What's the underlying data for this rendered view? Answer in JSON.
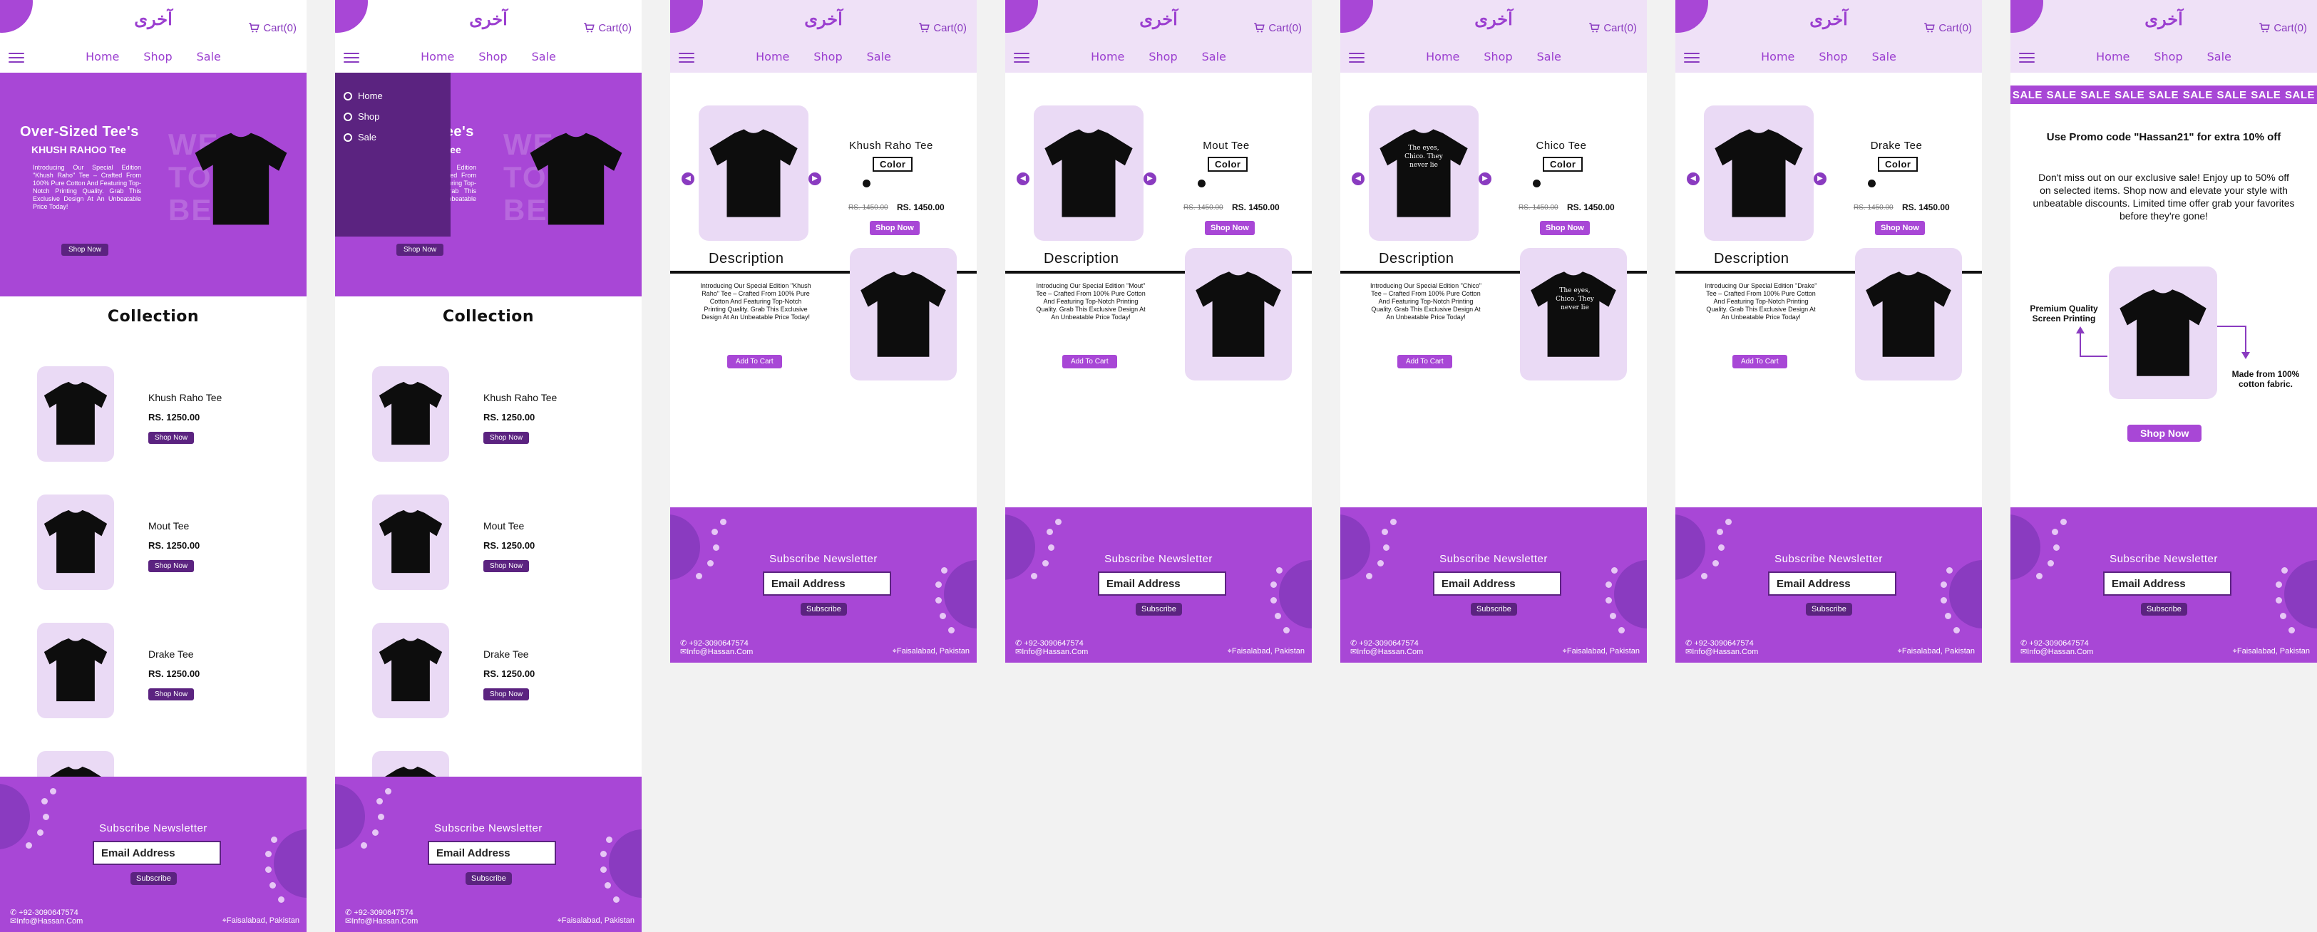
{
  "brand": {
    "logo_text": "آخری",
    "cart_label": "Cart(0)"
  },
  "nav": {
    "home": "Home",
    "shop": "Shop",
    "sale": "Sale"
  },
  "hero": {
    "title": "Over-Sized Tee's",
    "subtitle": "KHUSH RAHOO Tee",
    "text": "Introducing Our Special Edition \"Khush Raho\" Tee – Crafted From 100% Pure Cotton And Featuring Top-Notch Printing Quality. Grab This Exclusive Design At An Unbeatable Price Today!",
    "ghost_text": "WE\nTO\nBE",
    "button": "Shop Now"
  },
  "collection": {
    "title": "Collection",
    "items": [
      {
        "name": "Khush Raho Tee",
        "price": "RS. 1250.00",
        "button": "Shop Now"
      },
      {
        "name": "Mout Tee",
        "price": "RS. 1250.00",
        "button": "Shop Now"
      },
      {
        "name": "Drake Tee",
        "price": "RS. 1250.00",
        "button": "Shop Now"
      }
    ]
  },
  "menu": {
    "items": [
      "Home",
      "Shop",
      "Sale"
    ]
  },
  "footer": {
    "title": "Subscribe Newsletter",
    "email_placeholder": "Email Address",
    "subscribe": "Subscribe",
    "phone": "+92-3090647574",
    "email": "Info@Hassan.Com",
    "location": "Faisalabad, Pakistan"
  },
  "details": [
    {
      "name": "Khush Raho Tee",
      "color_label": "Color",
      "old_price": "RS. 1450.00",
      "new_price": "RS. 1450.00",
      "button": "Shop Now",
      "desc_title": "Description",
      "desc": "Introducing Our Special Edition \"Khush Raho\" Tee – Crafted From 100% Pure Cotton And Featuring Top-Notch Printing Quality. Grab This Exclusive Design At An Unbeatable Price Today!",
      "add": "Add To Cart"
    },
    {
      "name": "Mout Tee",
      "color_label": "Color",
      "old_price": "RS. 1450.00",
      "new_price": "RS. 1450.00",
      "button": "Shop Now",
      "desc_title": "Description",
      "desc": "Introducing Our Special Edition \"Mout\" Tee – Crafted From 100% Pure Cotton And Featuring Top-Notch Printing Quality. Grab This Exclusive Design At An Unbeatable Price Today!",
      "add": "Add To Cart"
    },
    {
      "name": "Chico Tee",
      "color_label": "Color",
      "old_price": "RS. 1450.00",
      "new_price": "RS. 1450.00",
      "button": "Shop Now",
      "desc_title": "Description",
      "desc": "Introducing Our Special Edition \"Chico\" Tee – Crafted From 100% Pure Cotton And Featuring Top-Notch Printing Quality. Grab This Exclusive Design At An Unbeatable Price Today!",
      "add": "Add To Cart",
      "print_text": "The eyes, Chico. They never lie"
    },
    {
      "name": "Drake Tee",
      "color_label": "Color",
      "old_price": "RS. 1450.00",
      "new_price": "RS. 1450.00",
      "button": "Shop Now",
      "desc_title": "Description",
      "desc": "Introducing Our Special Edition \"Drake\" Tee – Crafted From 100% Pure Cotton And Featuring Top-Notch Printing Quality. Grab This Exclusive Design At An Unbeatable Price Today!",
      "add": "Add To Cart"
    }
  ],
  "sale": {
    "strip": [
      "SALE",
      "SALE",
      "SALE",
      "SALE",
      "SALE",
      "SALE",
      "SALE",
      "SALE",
      "SALE"
    ],
    "promo": "Use Promo code \"Hassan21\" for extra 10% off",
    "text": "Don't miss out on our exclusive sale! Enjoy up to 50% off on selected items. Shop now and elevate your style with unbeatable discounts. Limited time offer grab your favorites before they're gone!",
    "label_left": "Premium Quality Screen Printing",
    "label_right": "Made from 100% cotton fabric.",
    "button": "Shop Now"
  },
  "colors": {
    "accent": "#a847d6",
    "dark": "#5b2380",
    "tint": "#efe1f7"
  }
}
